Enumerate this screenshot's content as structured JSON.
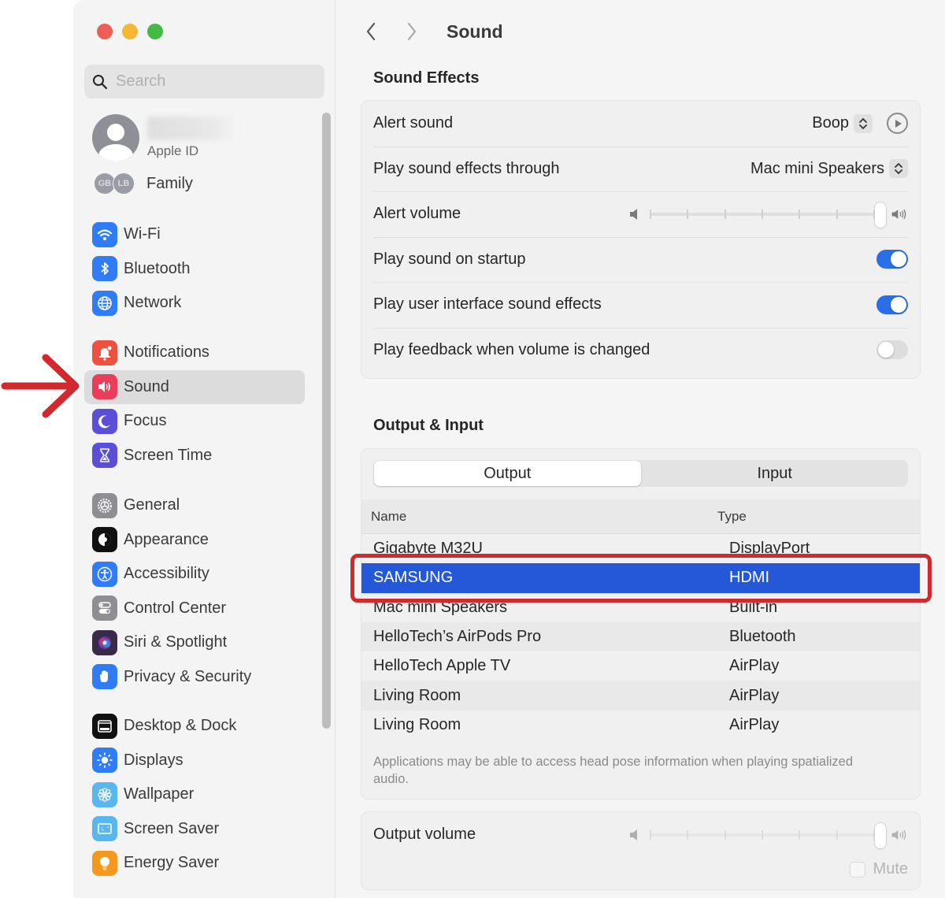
{
  "window": {
    "title": "Sound",
    "traffic_lights": [
      "close",
      "minimize",
      "zoom"
    ]
  },
  "sidebar": {
    "search": {
      "placeholder": "Search",
      "value": ""
    },
    "account": {
      "subtitle": "Apple ID"
    },
    "family": {
      "label": "Family",
      "initials": [
        "GB",
        "LB"
      ]
    },
    "groups": [
      [
        {
          "label": "Wi-Fi",
          "icon": "wifi-icon",
          "color": "#2f7cf6"
        },
        {
          "label": "Bluetooth",
          "icon": "bluetooth-icon",
          "color": "#2f7cf6"
        },
        {
          "label": "Network",
          "icon": "globe-icon",
          "color": "#2f7cf6"
        }
      ],
      [
        {
          "label": "Notifications",
          "icon": "bell-icon",
          "color": "#ee5140"
        },
        {
          "label": "Sound",
          "icon": "speaker-icon",
          "color": "#ea3d5c",
          "active": true
        },
        {
          "label": "Focus",
          "icon": "moon-icon",
          "color": "#5a4fd6"
        },
        {
          "label": "Screen Time",
          "icon": "hourglass-icon",
          "color": "#5a4fd6"
        }
      ],
      [
        {
          "label": "General",
          "icon": "gear-icon",
          "color": "#8e8e93"
        },
        {
          "label": "Appearance",
          "icon": "appearance-icon",
          "color": "#111111"
        },
        {
          "label": "Accessibility",
          "icon": "accessibility-icon",
          "color": "#2f7cf6"
        },
        {
          "label": "Control Center",
          "icon": "switches-icon",
          "color": "#8e8e93"
        },
        {
          "label": "Siri & Spotlight",
          "icon": "siri-icon",
          "color": "#3a2a4a"
        },
        {
          "label": "Privacy & Security",
          "icon": "hand-icon",
          "color": "#2f7cf6"
        }
      ],
      [
        {
          "label": "Desktop & Dock",
          "icon": "dock-icon",
          "color": "#111111"
        },
        {
          "label": "Displays",
          "icon": "sun-icon",
          "color": "#2f7cf6"
        },
        {
          "label": "Wallpaper",
          "icon": "flower-icon",
          "color": "#5ab6ef"
        },
        {
          "label": "Screen Saver",
          "icon": "screensaver-icon",
          "color": "#5ab6ef"
        },
        {
          "label": "Energy Saver",
          "icon": "lightbulb-icon",
          "color": "#f39a1e"
        }
      ]
    ]
  },
  "header": {
    "back_label": "Back",
    "forward_label": "Forward",
    "title": "Sound"
  },
  "sound_effects": {
    "title": "Sound Effects",
    "alert_sound": {
      "label": "Alert sound",
      "value": "Boop"
    },
    "play_through": {
      "label": "Play sound effects through",
      "value": "Mac mini Speakers"
    },
    "alert_volume": {
      "label": "Alert volume",
      "level": 1.0
    },
    "startup": {
      "label": "Play sound on startup",
      "on": true
    },
    "ui_effects": {
      "label": "Play user interface sound effects",
      "on": true
    },
    "feedback": {
      "label": "Play feedback when volume is changed",
      "on": false
    }
  },
  "output_input": {
    "title": "Output & Input",
    "tabs": [
      {
        "label": "Output",
        "selected": true
      },
      {
        "label": "Input",
        "selected": false
      }
    ],
    "columns": {
      "name": "Name",
      "type": "Type"
    },
    "devices": [
      {
        "name": "Gigabyte M32U",
        "type": "DisplayPort"
      },
      {
        "name": "SAMSUNG",
        "type": "HDMI",
        "selected": true
      },
      {
        "name": "Mac mini Speakers",
        "type": "Built-in"
      },
      {
        "name": "HelloTech’s AirPods Pro",
        "type": "Bluetooth"
      },
      {
        "name": "HelloTech Apple TV",
        "type": "AirPlay"
      },
      {
        "name": "Living Room",
        "type": "AirPlay"
      },
      {
        "name": "Living Room",
        "type": "AirPlay"
      }
    ],
    "note": "Applications may be able to access head pose information when playing spatialized audio."
  },
  "output_volume": {
    "label": "Output volume",
    "level": 1.0,
    "mute_label": "Mute",
    "muted": false
  },
  "annotations": {
    "arrow_color": "#d12a2e",
    "highlight_color": "#d12a2e"
  }
}
